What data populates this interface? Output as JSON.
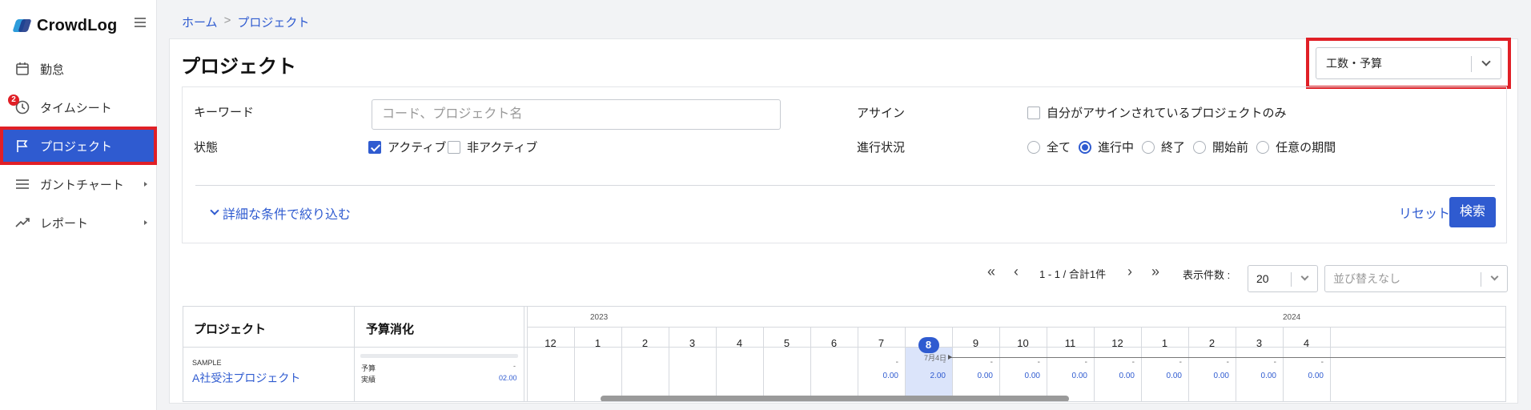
{
  "app": {
    "name": "CrowdLog"
  },
  "sidebar": {
    "items": [
      {
        "label": "勤怠",
        "icon": "calendar-icon"
      },
      {
        "label": "タイムシート",
        "icon": "clock-icon",
        "badge": "2"
      },
      {
        "label": "プロジェクト",
        "icon": "flag-icon",
        "active": true
      },
      {
        "label": "ガントチャート",
        "icon": "list-icon",
        "has_submenu": true
      },
      {
        "label": "レポート",
        "icon": "trend-icon",
        "has_submenu": true
      }
    ]
  },
  "breadcrumb": {
    "home": "ホーム",
    "separator": ">",
    "current": "プロジェクト"
  },
  "page": {
    "title": "プロジェクト",
    "mode_select": "工数・予算"
  },
  "filter": {
    "keyword_label": "キーワード",
    "keyword_placeholder": "コード、プロジェクト名",
    "assign_label": "アサイン",
    "assign_option": "自分がアサインされているプロジェクトのみ",
    "status_label": "状態",
    "status_active": "アクティブ",
    "status_inactive": "非アクティブ",
    "progress_label": "進行状況",
    "progress_options": [
      "全て",
      "進行中",
      "終了",
      "開始前",
      "任意の期間"
    ],
    "progress_selected": "進行中",
    "detail_link": "詳細な条件で絞り込む",
    "reset": "リセット",
    "search": "検索"
  },
  "pagination": {
    "range": "1 - 1 / 合計1件",
    "per_page_label": "表示件数 :",
    "per_page": "20",
    "sort_placeholder": "並び替えなし"
  },
  "table": {
    "col_project": "プロジェクト",
    "col_budget": "予算消化",
    "years": [
      "2023",
      "2024"
    ],
    "months": [
      "12",
      "1",
      "2",
      "3",
      "4",
      "5",
      "6",
      "7",
      "8",
      "9",
      "10",
      "11",
      "12",
      "1",
      "2",
      "3",
      "4"
    ],
    "current_month": "8",
    "row": {
      "code": "SAMPLE",
      "name": "A社受注プロジェクト",
      "budget_label": "予算",
      "actual_label": "実績",
      "budget_value": "-",
      "actual_value": "02.00",
      "start_marker": "7月4日",
      "month_values": [
        "",
        "",
        "",
        "",
        "",
        "",
        "",
        "0.00",
        "2.00",
        "0.00",
        "0.00",
        "0.00",
        "0.00",
        "0.00",
        "0.00",
        "0.00",
        "0.00"
      ],
      "month_dashes": [
        "",
        "",
        "",
        "",
        "",
        "",
        "",
        "-",
        "-",
        "-",
        "-",
        "-",
        "-",
        "-",
        "-",
        "-",
        "-"
      ]
    }
  },
  "colors": {
    "accent": "#2f5bd0",
    "highlight": "#e01f26"
  }
}
